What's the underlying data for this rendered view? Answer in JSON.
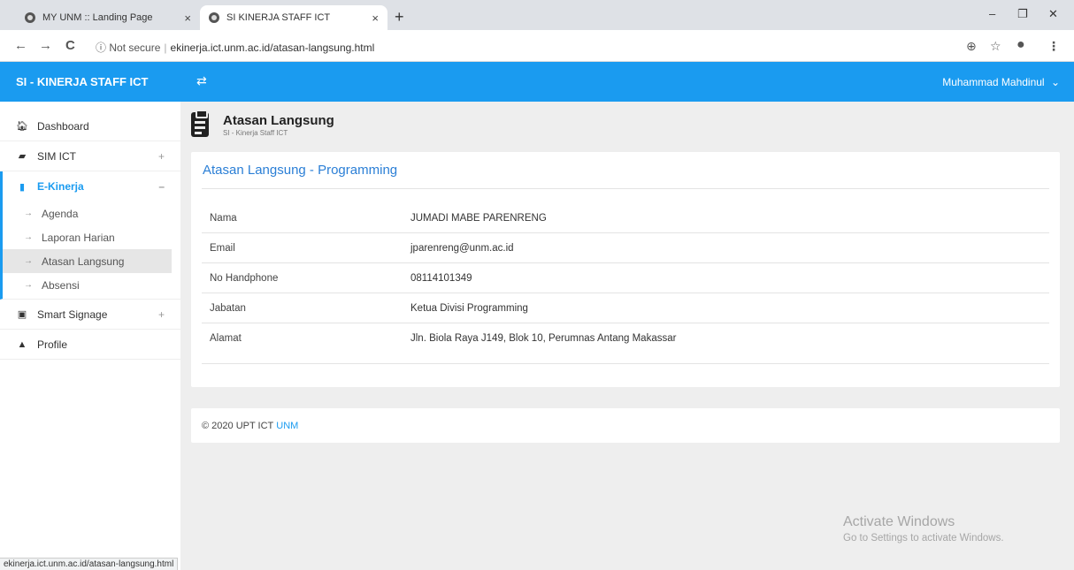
{
  "browser": {
    "tabs": [
      {
        "title": "MY UNM :: Landing Page",
        "close": "×"
      },
      {
        "title": "SI KINERJA STAFF ICT",
        "close": "×"
      }
    ],
    "new_tab": "+",
    "controls": {
      "minimize": "–",
      "restore": "❐",
      "close": "✕"
    },
    "nav": {
      "back": "←",
      "forward": "→",
      "reload": "C"
    },
    "security_icon": "ⓘ",
    "security_label": "Not secure",
    "url": "ekinerja.ict.unm.ac.id/atasan-langsung.html",
    "icons": {
      "zoom": "⊕",
      "star": "☆",
      "account": "●",
      "menu": "⋮"
    },
    "status_url": "ekinerja.ict.unm.ac.id/atasan-langsung.html"
  },
  "header": {
    "brand": "SI - KINERJA STAFF ICT",
    "toggle_icon": "⇄",
    "user": "Muhammad Mahdinul",
    "user_caret": "⌄",
    "color": "#1a9bf0"
  },
  "sidebar": {
    "items": [
      {
        "label": "Dashboard",
        "icon": "home-icon",
        "glyph": "🏠︎"
      },
      {
        "label": "SIM ICT",
        "icon": "id-card-icon",
        "glyph": "▰",
        "toggle": "+"
      },
      {
        "label": "E-Kinerja",
        "icon": "clipboard-icon",
        "glyph": "▮",
        "toggle": "–"
      },
      {
        "label": "Smart Signage",
        "icon": "chart-icon",
        "glyph": "▣",
        "toggle": "+"
      },
      {
        "label": "Profile",
        "icon": "user-icon",
        "glyph": "▲"
      }
    ],
    "submenu": [
      {
        "label": "Agenda"
      },
      {
        "label": "Laporan Harian"
      },
      {
        "label": "Atasan Langsung"
      },
      {
        "label": "Absensi"
      }
    ],
    "sub_arrow": "→"
  },
  "page": {
    "title": "Atasan Langsung",
    "subtitle": "SI - Kinerja Staff ICT"
  },
  "card": {
    "title": "Atasan Langsung - Programming",
    "rows": [
      {
        "label": "Nama",
        "value": "JUMADI MABE PARENRENG"
      },
      {
        "label": "Email",
        "value": "jparenreng@unm.ac.id"
      },
      {
        "label": "No Handphone",
        "value": "08114101349"
      },
      {
        "label": "Jabatan",
        "value": "Ketua Divisi Programming"
      },
      {
        "label": "Alamat",
        "value": "Jln. Biola Raya J149, Blok 10, Perumnas Antang Makassar"
      }
    ]
  },
  "footer": {
    "text": "© 2020 UPT ICT",
    "link": "UNM"
  },
  "watermark": {
    "line1": "Activate Windows",
    "line2": "Go to Settings to activate Windows."
  }
}
